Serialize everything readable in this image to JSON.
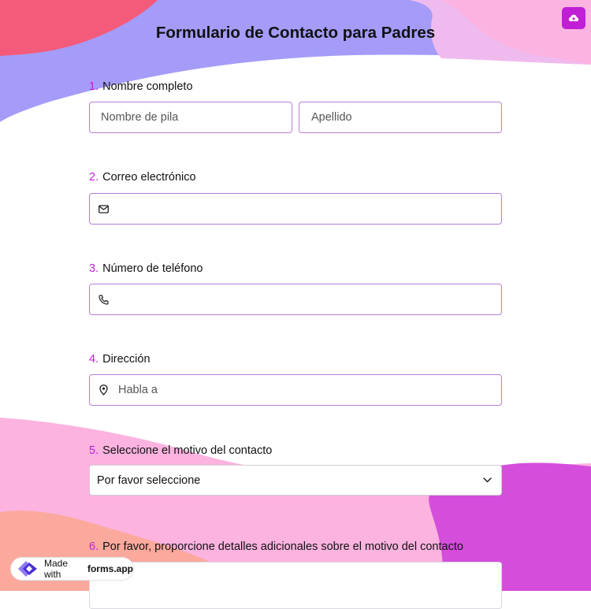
{
  "form": {
    "title": "Formulario de Contacto para Padres"
  },
  "questions": [
    {
      "number": "1.",
      "label": "Nombre completo"
    },
    {
      "number": "2.",
      "label": "Correo electrónico"
    },
    {
      "number": "3.",
      "label": "Número de teléfono"
    },
    {
      "number": "4.",
      "label": "Dirección"
    },
    {
      "number": "5.",
      "label": "Seleccione el motivo del contacto"
    },
    {
      "number": "6.",
      "label": "Por favor, proporcione detalles adicionales sobre el motivo del contacto"
    }
  ],
  "fields": {
    "first_name_placeholder": "Nombre de pila",
    "last_name_placeholder": "Apellido",
    "email_value": "",
    "phone_value": "",
    "address_placeholder": "Habla a",
    "reason_selected": "Por favor seleccione"
  },
  "badge": {
    "prefix": "Made with",
    "brand": "forms.app"
  },
  "colors": {
    "accent": "#c11fd6",
    "field_border": "#b57fd6"
  }
}
